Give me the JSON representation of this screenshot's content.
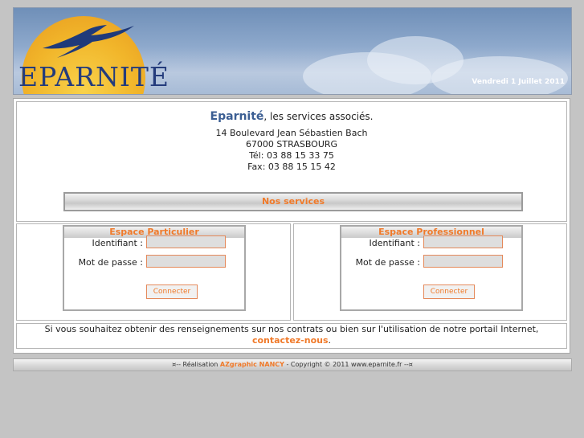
{
  "header": {
    "logo_text": "EPARNITÉ",
    "date": "Vendredi 1 Juillet 2011"
  },
  "intro": {
    "brand": "Eparnité",
    "tagline": ", les services associés.",
    "address_line1": "14 Boulevard Jean Sébastien Bach",
    "address_line2": "67000 STRASBOURG",
    "phone": "Tél: 03 88 15 33 75",
    "fax": "Fax: 03 88 15 15 42",
    "services_label": "Nos services"
  },
  "particulier": {
    "title": "Espace Particulier",
    "id_label": "Identifiant :",
    "pwd_label": "Mot de passe :",
    "id_value": "",
    "pwd_value": "",
    "button": "Connecter"
  },
  "professionnel": {
    "title": "Espace Professionnel",
    "id_label": "Identifiant :",
    "pwd_label": "Mot de passe :",
    "id_value": "",
    "pwd_value": "",
    "button": "Connecter"
  },
  "note": {
    "text": "Si vous souhaitez obtenir des renseignements sur nos contrats ou bien sur l'utilisation de notre portail Internet,",
    "link": "contactez-nous",
    "end": "."
  },
  "footer": {
    "prefix": "¤-- Réalisation ",
    "link": "AZgraphic NANCY",
    "suffix": " - Copyright © 2011 www.eparnite.fr --¤"
  }
}
